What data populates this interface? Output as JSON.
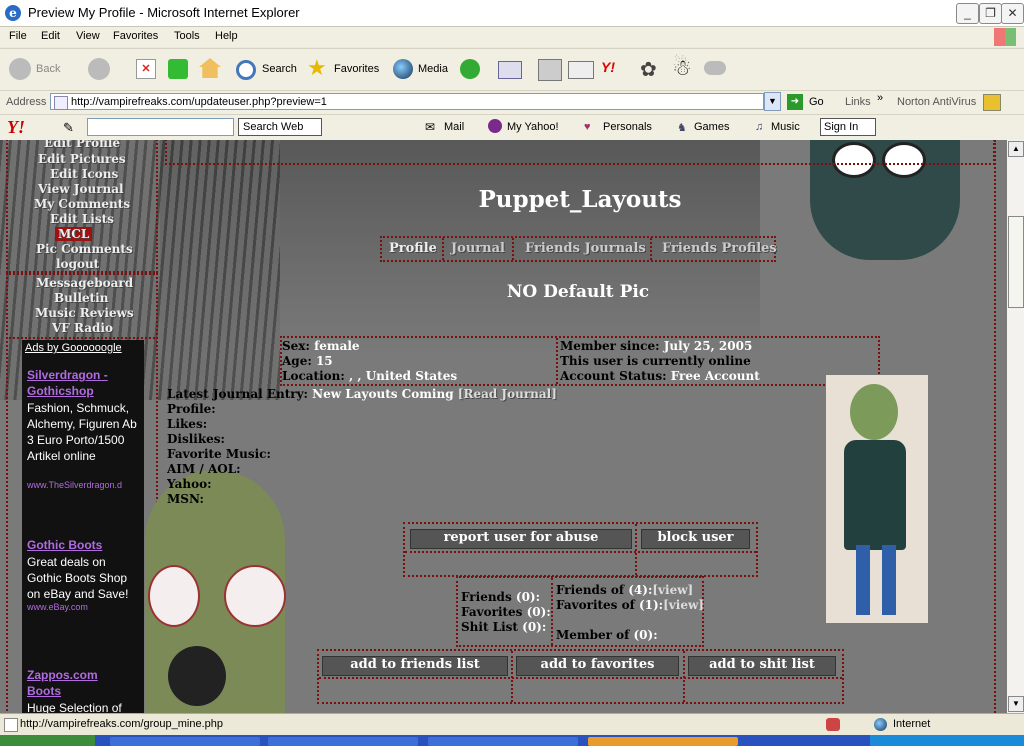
{
  "window": {
    "title": "Preview My Profile - Microsoft Internet Explorer"
  },
  "menu": [
    "File",
    "Edit",
    "View",
    "Favorites",
    "Tools",
    "Help"
  ],
  "toolbar": {
    "back": "Back",
    "search": "Search",
    "favorites": "Favorites",
    "media": "Media"
  },
  "address": {
    "label": "Address",
    "url": "http://vampirefreaks.com/updateuser.php?preview=1",
    "go": "Go",
    "links": "Links",
    "norton": "Norton AntiVirus"
  },
  "yahoo": {
    "search_button": "Search Web",
    "mail": "Mail",
    "my_yahoo": "My Yahoo!",
    "personals": "Personals",
    "games": "Games",
    "music": "Music",
    "sign_in": "Sign In"
  },
  "left_nav": {
    "items": [
      "Edit Profile",
      "Edit Pictures",
      "Edit Icons",
      "View Journal",
      "My Comments",
      "Edit Lists",
      "MCL",
      "Pic Comments",
      "logout"
    ],
    "items2": [
      "Messageboard",
      "Bulletin",
      "Music Reviews",
      "VF Radio"
    ]
  },
  "ads": {
    "header": "Ads by Goooooogle",
    "items": [
      {
        "title1": "Silverdragon -",
        "title2": "Gothicshop",
        "text": "Fashion, Schmuck, Alchemy, Figuren Ab 3 Euro Porto/1500 Artikel online",
        "url": "www.TheSilverdragon.d"
      },
      {
        "title1": "Gothic Boots",
        "title2": "",
        "text": "Great deals on Gothic Boots Shop on eBay and Save!",
        "url": "www.eBay.com"
      },
      {
        "title1": "Zappos.com",
        "title2": "Boots",
        "text": "Huge Selection of",
        "url": ""
      }
    ]
  },
  "profile": {
    "username": "Puppet_Layouts",
    "tabs": [
      "Profile",
      "Journal",
      "Friends Journals",
      "Friends Profiles"
    ],
    "no_pic": "NO Default Pic",
    "sex_label": "Sex:",
    "sex": "female",
    "age_label": "Age:",
    "age": "15",
    "location_label": "Location:",
    "location": ", , United States",
    "member_since_label": "Member since:",
    "member_since": "July 25, 2005",
    "online": "This user is currently online",
    "account_status_label": "Account Status:",
    "account_status": "Free Account",
    "journal_label": "Latest Journal Entry:",
    "journal_entry": "New Layouts Coming",
    "read_journal": "[Read Journal]",
    "fields": [
      "Profile:",
      "Likes:",
      "Dislikes:",
      "Favorite Music:",
      "AIM / AOL:",
      "Yahoo:",
      "MSN:"
    ]
  },
  "actions": {
    "report": "report user for abuse",
    "block": "block user",
    "add_friends": "add to friends list",
    "add_favorites": "add to favorites",
    "add_shit": "add to shit list"
  },
  "stats": {
    "friends_label": "Friends",
    "friends_count": "(0):",
    "favorites_label": "Favorites",
    "favorites_count": "(0):",
    "shitlist_label": "Shit List",
    "shitlist_count": "(0):",
    "friends_of_label": "Friends of",
    "friends_of_count": "(4):",
    "view1": "[view]",
    "favorites_of_label": "Favorites of",
    "favorites_of_count": "(1):",
    "view2": "[view]",
    "member_of_label": "Member of",
    "member_of_count": "(0):"
  },
  "status": {
    "url": "http://vampirefreaks.com/group_mine.php",
    "zone": "Internet"
  }
}
